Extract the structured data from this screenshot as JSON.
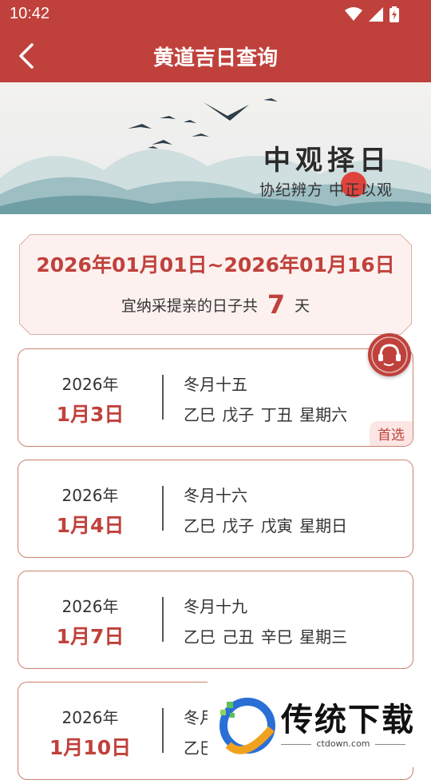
{
  "status_bar": {
    "time": "10:42"
  },
  "header": {
    "title": "黄道吉日查询"
  },
  "banner": {
    "title": "中观择日",
    "subtitle": "协纪辨方 中正以观"
  },
  "summary": {
    "range": "2026年01月01日~2026年01月16日",
    "count_prefix": "宜纳采提亲的日子共",
    "count": "7",
    "count_suffix": "天"
  },
  "results": [
    {
      "year": "2026年",
      "day": "1月3日",
      "lunar": "冬月十五",
      "ganzhi": "乙巳 戊子 丁丑 星期六",
      "badge": "首选"
    },
    {
      "year": "2026年",
      "day": "1月4日",
      "lunar": "冬月十六",
      "ganzhi": "乙巳 戊子 戊寅 星期日"
    },
    {
      "year": "2026年",
      "day": "1月7日",
      "lunar": "冬月十九",
      "ganzhi": "乙巳 己丑 辛巳 星期三"
    },
    {
      "year": "2026年",
      "day": "1月10日",
      "lunar": "冬月",
      "ganzhi": "乙巳"
    }
  ],
  "watermark": {
    "name": "传统下载",
    "url": "ctdown.com"
  },
  "colors": {
    "primary": "#c0413c",
    "card_border": "#c9826f",
    "summary_bg": "#fdf1ef"
  },
  "icons": [
    "back-arrow-icon",
    "wifi-icon",
    "signal-icon",
    "battery-icon",
    "customer-service-icon"
  ]
}
